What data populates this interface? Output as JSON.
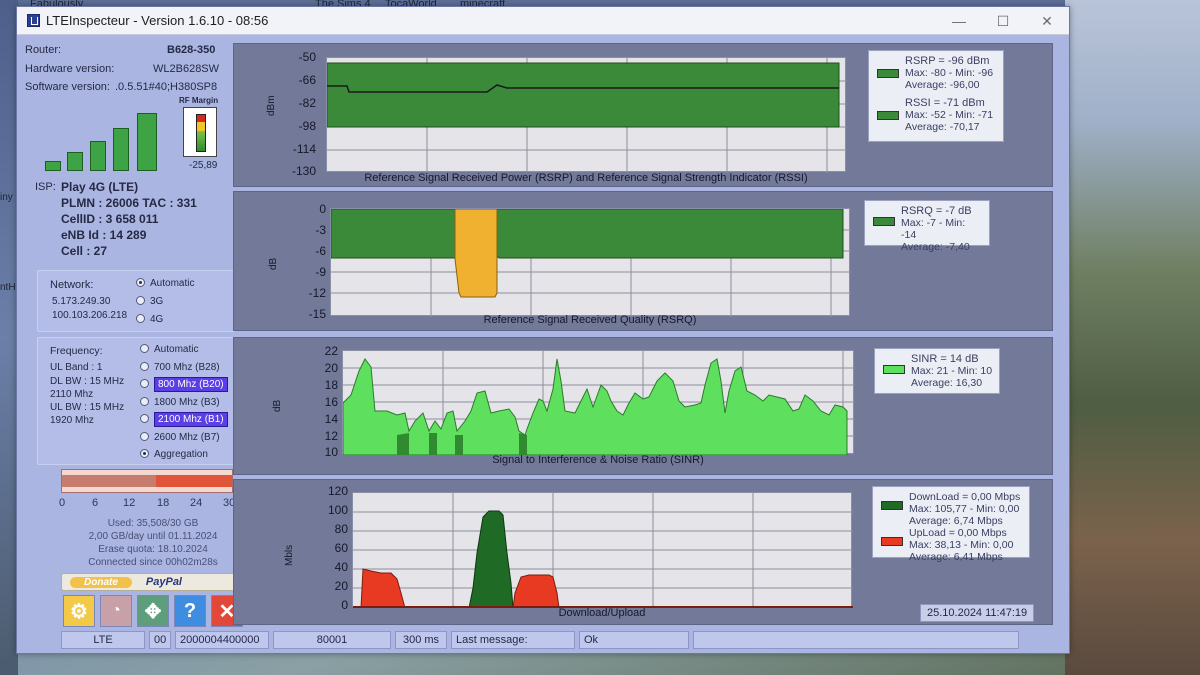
{
  "desktop": {
    "top_labels": [
      "Fabulously",
      "The Sims 4",
      "TocaWorld",
      "minecraft"
    ],
    "left_labels": [
      "iny",
      "ntHol"
    ]
  },
  "window": {
    "title": "LTEInspecteur - Version 1.6.10 - 08:56",
    "controls": {
      "minimize": "—",
      "maximize": "☐",
      "close": "✕"
    }
  },
  "device": {
    "router_label": "Router:",
    "router": "B628-350",
    "hw_label": "Hardware version:",
    "hw": "WL2B628SW",
    "sw_label": "Software version:",
    "sw": ".0.5.51#40;H380SP8",
    "rf_margin_label": "RF Margin",
    "rf_margin_value": "-25,89",
    "signal_bars": 5
  },
  "cell": {
    "isp_label": "ISP:",
    "isp": "Play 4G (LTE)",
    "plmn": "PLMN : 26006 TAC : 331",
    "cellid": "CellID : 3 658 011",
    "enb": "eNB Id : 14 289",
    "cell": "Cell : 27"
  },
  "network": {
    "label": "Network:",
    "ip1": "5.173.249.30",
    "ip2": "100.103.206.218",
    "options": [
      "Automatic",
      "3G",
      "4G"
    ],
    "selected": "Automatic"
  },
  "frequency": {
    "label": "Frequency:",
    "info": [
      "UL Band : 1",
      "DL BW : 15 MHz",
      "2110 Mhz",
      "UL BW : 15 MHz",
      "1920 Mhz"
    ],
    "options": [
      "Automatic",
      "700 Mhz (B28)",
      "800 Mhz (B20)",
      "1800 Mhz (B3)",
      "2100 Mhz (B1)",
      "2600 Mhz (B7)",
      "Aggregation"
    ],
    "highlighted": [
      "800 Mhz (B20)",
      "2100 Mhz (B1)"
    ],
    "selected": "Aggregation"
  },
  "usage": {
    "scale": [
      "0",
      "6",
      "12",
      "18",
      "24",
      "30"
    ],
    "used": "Used: 35,508/30 GB",
    "per_day": "2,00 GB/day until 01.11.2024",
    "erase": "Erase quota: 18.10.2024",
    "connected": "Connected since 00h02m28s",
    "fill_fraction": 1.0
  },
  "donate": {
    "donate": "Donate",
    "paypal": "PayPal"
  },
  "buttons": {
    "settings_icon": "gear-icon",
    "speed_icon": "speedometer-icon",
    "fullscreen_icon": "expand-icon",
    "help_icon": "help-icon",
    "exit_icon": "close-icon",
    "help_glyph": "?",
    "exit_glyph": "✕"
  },
  "charts": {
    "rsrp": {
      "title": "Reference Signal Received Power (RSRP) and Reference Signal Strength Indicator (RSSI)",
      "ylabel": "dBm",
      "yticks": [
        "-50",
        "-66",
        "-82",
        "-98",
        "-114",
        "-130"
      ],
      "legend_rsrp": [
        "RSRP = -96 dBm",
        "Max: -80 - Min: -96",
        "Average: -96,00"
      ],
      "legend_rssi": [
        "RSSI = -71 dBm",
        "Max: -52 - Min: -71",
        "Average: -70,17"
      ],
      "color": "#3a8a3a"
    },
    "rsrq": {
      "title": "Reference Signal Received Quality (RSRQ)",
      "ylabel": "dB",
      "yticks": [
        "0",
        "-3",
        "-6",
        "-9",
        "-12",
        "-15"
      ],
      "legend": [
        "RSRQ = -7 dB",
        "Max: -7 - Min: -14",
        "Average: -7,40"
      ],
      "color": "#3a8a3a",
      "warn_color": "#f0b030"
    },
    "sinr": {
      "title": "Signal to Interference & Noise Ratio (SINR)",
      "ylabel": "dB",
      "yticks": [
        "22",
        "20",
        "18",
        "16",
        "14",
        "12",
        "10"
      ],
      "legend": [
        "SINR = 14 dB",
        "Max: 21 - Min: 10",
        "Average: 16,30"
      ],
      "color": "#5ee05e"
    },
    "dlul": {
      "title": "Download/Upload",
      "ylabel": "Mbls",
      "yticks": [
        "120",
        "100",
        "80",
        "60",
        "40",
        "20",
        "0"
      ],
      "legend_dl": [
        "DownLoad = 0,00 Mbps",
        "Max: 105,77 - Min: 0,00",
        "Average: 6,74 Mbps"
      ],
      "legend_ul": [
        "UpLoad = 0,00 Mbps",
        "Max: 38,13 - Min: 0,00",
        "Average: 6,41 Mbps"
      ],
      "dl_color": "#1f6a25",
      "ul_color": "#e83a22",
      "datetime": "25.10.2024 11:47:19"
    }
  },
  "statusbar": {
    "tech": "LTE",
    "code": "00",
    "id": "2000004400000",
    "val": "80001",
    "ping": "300 ms",
    "lastmsg_label": "Last message:",
    "lastmsg": "Ok"
  }
}
